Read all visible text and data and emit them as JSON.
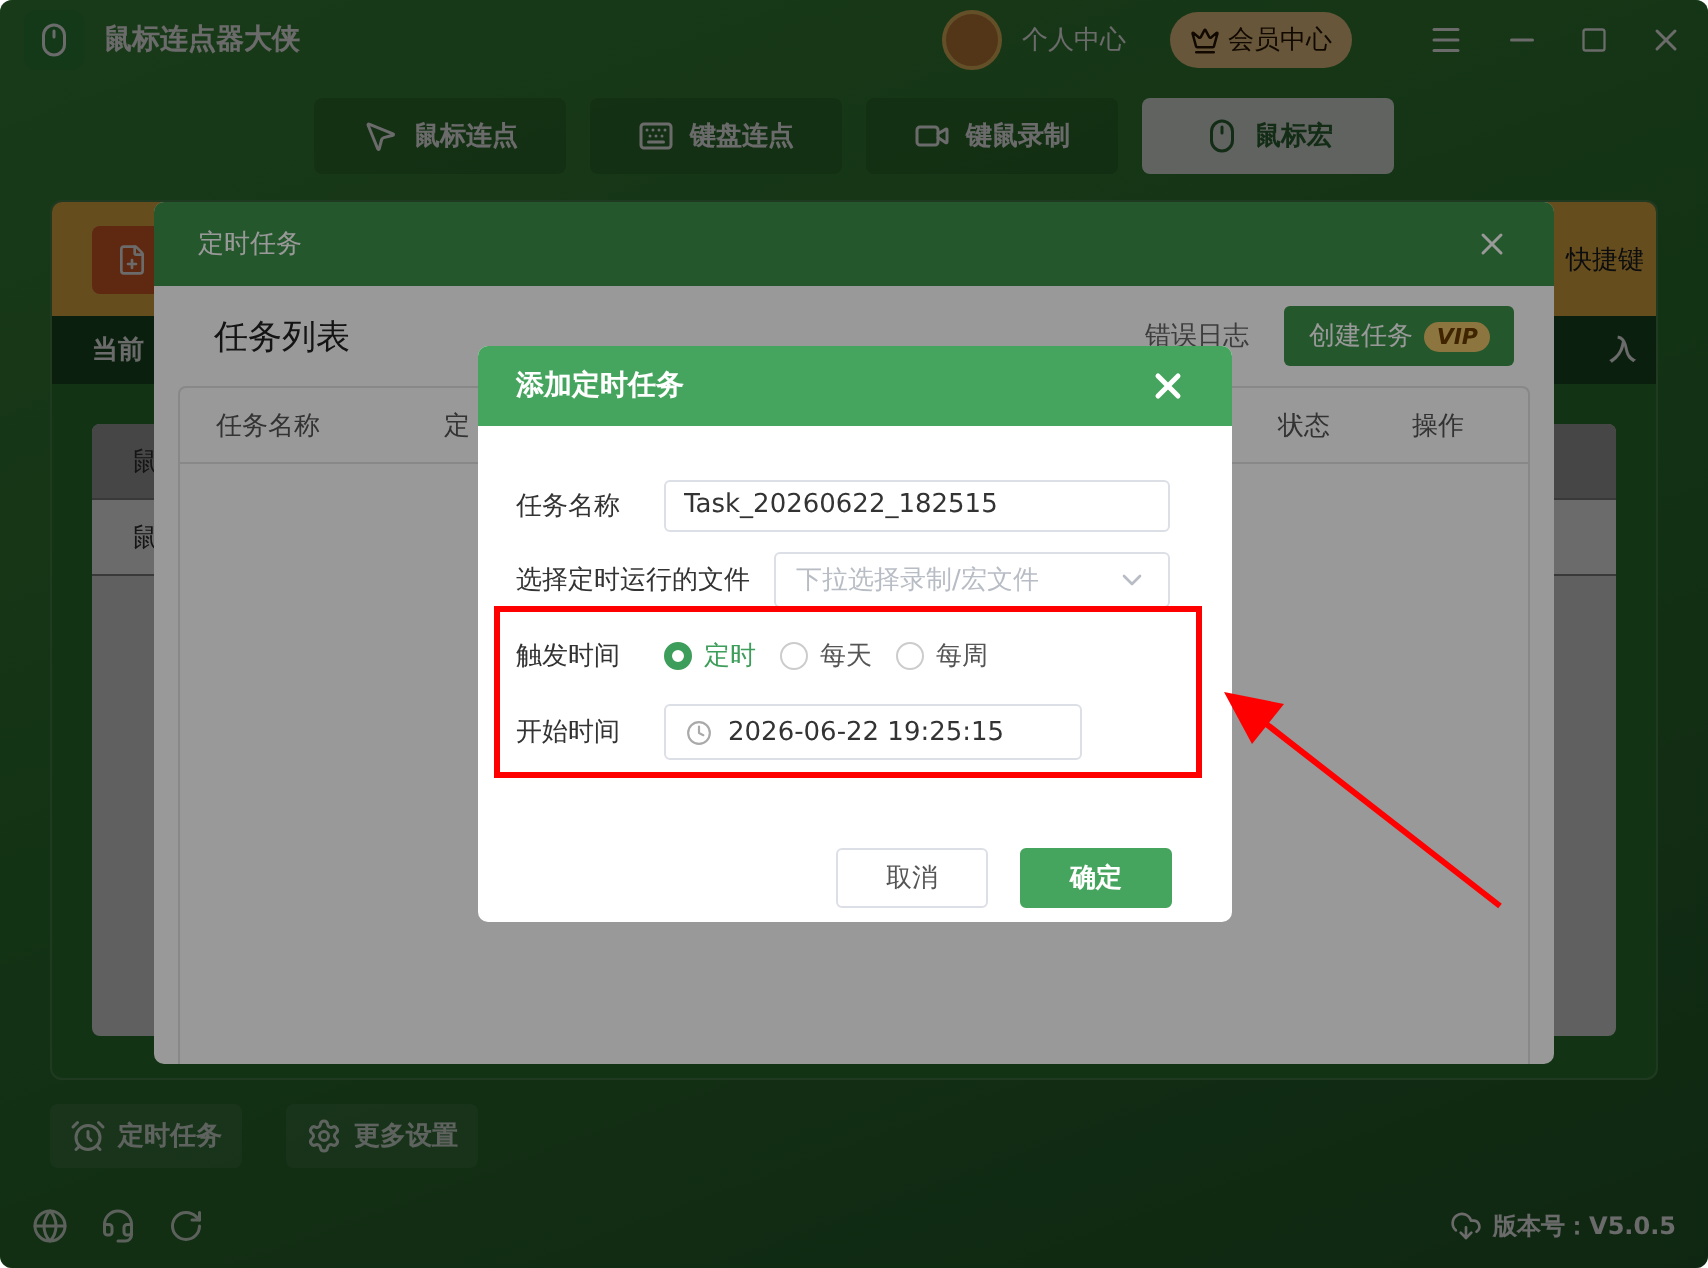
{
  "window": {
    "title": "鼠标连点器大侠"
  },
  "header": {
    "profile": "个人中心",
    "vip_button": "会员中心"
  },
  "nav_tabs": [
    {
      "label": "鼠标连点",
      "kind": "cursor",
      "selected": false
    },
    {
      "label": "键盘连点",
      "kind": "keyboard",
      "selected": false
    },
    {
      "label": "键鼠录制",
      "kind": "video",
      "selected": false
    },
    {
      "label": "鼠标宏",
      "kind": "mouse",
      "selected": true
    }
  ],
  "main_panel": {
    "banner_text": "快捷键",
    "status_text": "当前",
    "status_text_right": "入",
    "rows": [
      {
        "label": "鼠",
        "selected": false
      },
      {
        "label": "鼠",
        "selected": true
      }
    ]
  },
  "bottom_buttons": [
    {
      "label": "定时任务",
      "kind": "alarm"
    },
    {
      "label": "更多设置",
      "kind": "gear"
    }
  ],
  "footer": {
    "version": "版本号：V5.0.5"
  },
  "task_dialog": {
    "title": "定时任务",
    "heading": "任务列表",
    "error_log_link": "错误日志",
    "create_button": "创建任务",
    "create_badge": "VIP",
    "columns": [
      "任务名称",
      "定",
      "状态",
      "操作"
    ]
  },
  "add_dialog": {
    "title": "添加定时任务",
    "fields": [
      {
        "label": "任务名称",
        "kind": "text",
        "value": "Task_20260622_182515"
      },
      {
        "label": "选择定时运行的文件",
        "kind": "select",
        "placeholder": "下拉选择录制/宏文件"
      },
      {
        "label": "触发时间",
        "kind": "radio",
        "options": [
          {
            "label": "定时",
            "selected": true
          },
          {
            "label": "每天",
            "selected": false
          },
          {
            "label": "每周",
            "selected": false
          }
        ]
      },
      {
        "label": "开始时间",
        "kind": "datetime",
        "value": "2026-06-22 19:25:15"
      }
    ],
    "buttons": [
      {
        "label": "取消",
        "kind": "secondary"
      },
      {
        "label": "确定",
        "kind": "primary"
      }
    ]
  }
}
